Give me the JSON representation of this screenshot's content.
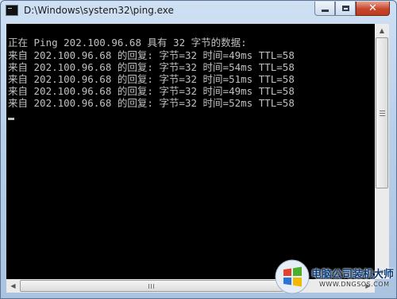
{
  "window": {
    "title": "D:\\Windows\\system32\\ping.exe",
    "icon": "console-icon",
    "controls": {
      "minimize": "minimize-icon",
      "maximize": "maximize-icon",
      "close": "close-icon"
    }
  },
  "console": {
    "lines": [
      "正在 Ping 202.100.96.68 具有 32 字节的数据:",
      "来自 202.100.96.68 的回复: 字节=32 时间=49ms TTL=58",
      "来自 202.100.96.68 的回复: 字节=32 时间=54ms TTL=58",
      "来自 202.100.96.68 的回复: 字节=32 时间=51ms TTL=58",
      "来自 202.100.96.68 的回复: 字节=32 时间=49ms TTL=58",
      "来自 202.100.96.68 的回复: 字节=32 时间=52ms TTL=58"
    ],
    "text_color": "#c0c0c0",
    "background": "#000000"
  },
  "watermark": {
    "name": "电脑公司装机大师",
    "url": "WWW.DNGSOS.COM"
  }
}
